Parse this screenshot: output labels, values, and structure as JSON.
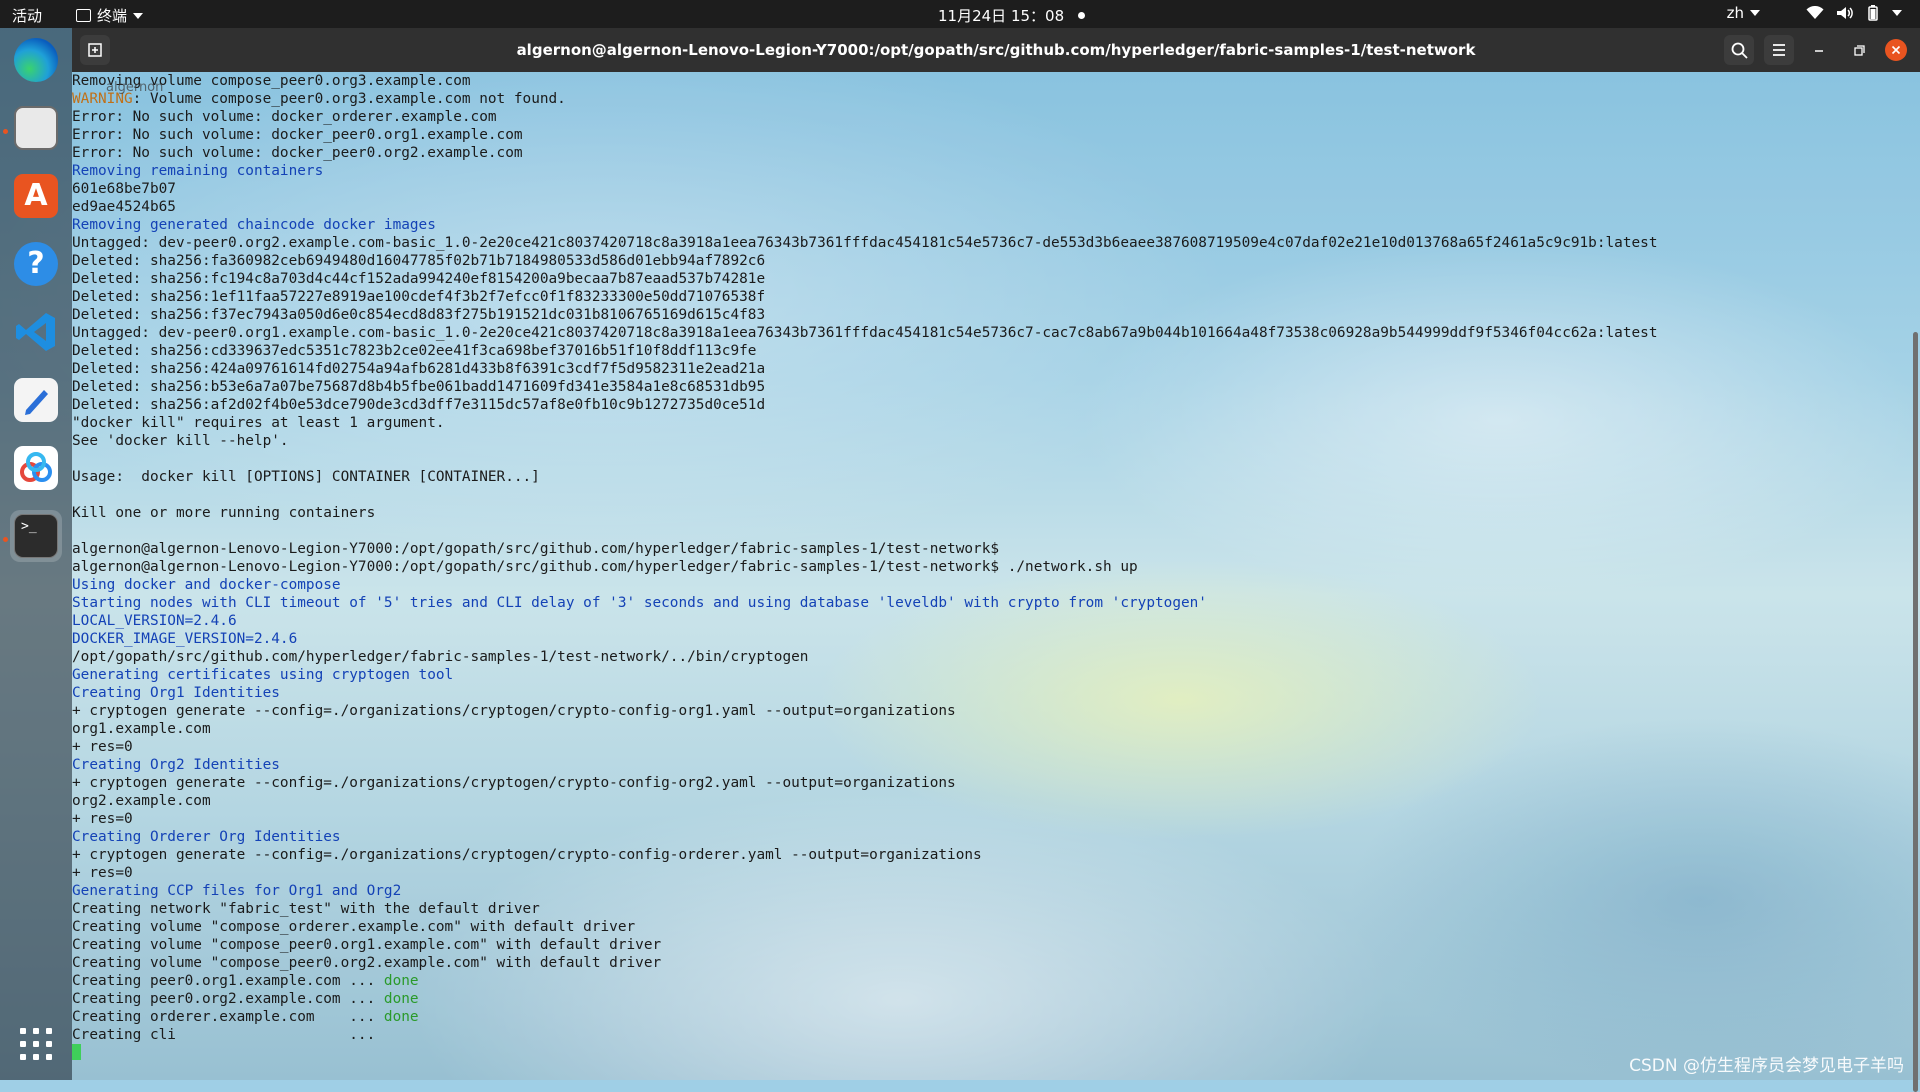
{
  "topbar": {
    "activities": "活动",
    "app_menu": "终端",
    "clock": "11月24日  15：08",
    "input_method": "zh"
  },
  "desktop": {
    "ghost_label": "algernon"
  },
  "dock": {
    "items": [
      {
        "name": "edge",
        "icon": "edge-icon"
      },
      {
        "name": "files",
        "icon": "files-icon"
      },
      {
        "name": "software",
        "icon": "software-store-icon"
      },
      {
        "name": "help",
        "icon": "help-icon"
      },
      {
        "name": "vscode",
        "icon": "vscode-icon"
      },
      {
        "name": "text-editor",
        "icon": "text-editor-icon"
      },
      {
        "name": "baidu-netdisk",
        "icon": "baidu-netdisk-icon"
      },
      {
        "name": "terminal",
        "icon": "terminal-icon"
      }
    ],
    "show_apps": "show-apps-icon"
  },
  "window": {
    "title": "algernon@algernon-Lenovo-Legion-Y7000:/opt/gopath/src/github.com/hyperledger/fabric-samples-1/test-network"
  },
  "terminal": {
    "lines": [
      [
        {
          "t": "Removing volume compose_peer0.org3.example.com"
        }
      ],
      [
        {
          "t": "WARNING",
          "c": "warn"
        },
        {
          "t": ": Volume compose_peer0.org3.example.com not found."
        }
      ],
      [
        {
          "t": "Error: No such volume: docker_orderer.example.com"
        }
      ],
      [
        {
          "t": "Error: No such volume: docker_peer0.org1.example.com"
        }
      ],
      [
        {
          "t": "Error: No such volume: docker_peer0.org2.example.com"
        }
      ],
      [
        {
          "t": "Removing remaining containers",
          "c": "blue"
        }
      ],
      [
        {
          "t": "601e68be7b07"
        }
      ],
      [
        {
          "t": "ed9ae4524b65"
        }
      ],
      [
        {
          "t": "Removing generated chaincode docker images",
          "c": "blue"
        }
      ],
      [
        {
          "t": "Untagged: dev-peer0.org2.example.com-basic_1.0-2e20ce421c8037420718c8a3918a1eea76343b7361fffdac454181c54e5736c7-de553d3b6eaee387608719509e4c07daf02e21e10d013768a65f2461a5c9c91b:latest"
        }
      ],
      [
        {
          "t": "Deleted: sha256:fa360982ceb6949480d16047785f02b71b7184980533d586d01ebb94af7892c6"
        }
      ],
      [
        {
          "t": "Deleted: sha256:fc194c8a703d4c44cf152ada994240ef8154200a9becaa7b87eaad537b74281e"
        }
      ],
      [
        {
          "t": "Deleted: sha256:1ef11faa57227e8919ae100cdef4f3b2f7efcc0f1f83233300e50dd71076538f"
        }
      ],
      [
        {
          "t": "Deleted: sha256:f37ec7943a050d6e0c854ecd8d83f275b191521dc031b8106765169d615c4f83"
        }
      ],
      [
        {
          "t": "Untagged: dev-peer0.org1.example.com-basic_1.0-2e20ce421c8037420718c8a3918a1eea76343b7361fffdac454181c54e5736c7-cac7c8ab67a9b044b101664a48f73538c06928a9b544999ddf9f5346f04cc62a:latest"
        }
      ],
      [
        {
          "t": "Deleted: sha256:cd339637edc5351c7823b2ce02ee41f3ca698bef37016b51f10f8ddf113c9fe"
        }
      ],
      [
        {
          "t": "Deleted: sha256:424a09761614fd02754a94afb6281d433b8f6391c3cdf7f5d9582311e2ead21a"
        }
      ],
      [
        {
          "t": "Deleted: sha256:b53e6a7a07be75687d8b4b5fbe061badd1471609fd341e3584a1e8c68531db95"
        }
      ],
      [
        {
          "t": "Deleted: sha256:af2d02f4b0e53dce790de3cd3dff7e3115dc57af8e0fb10c9b1272735d0ce51d"
        }
      ],
      [
        {
          "t": "\"docker kill\" requires at least 1 argument."
        }
      ],
      [
        {
          "t": "See 'docker kill --help'."
        }
      ],
      [
        {
          "t": ""
        }
      ],
      [
        {
          "t": "Usage:  docker kill [OPTIONS] CONTAINER [CONTAINER...]"
        }
      ],
      [
        {
          "t": ""
        }
      ],
      [
        {
          "t": "Kill one or more running containers"
        }
      ],
      [
        {
          "t": ""
        }
      ],
      [
        {
          "t": "algernon@algernon-Lenovo-Legion-Y7000:/opt/gopath/src/github.com/hyperledger/fabric-samples-1/test-network$"
        }
      ],
      [
        {
          "t": "algernon@algernon-Lenovo-Legion-Y7000:/opt/gopath/src/github.com/hyperledger/fabric-samples-1/test-network$ ./network.sh up"
        }
      ],
      [
        {
          "t": "Using docker and docker-compose",
          "c": "blue"
        }
      ],
      [
        {
          "t": "Starting nodes with CLI timeout of '5' tries and CLI delay of '3' seconds and using database 'leveldb' with crypto from 'cryptogen'",
          "c": "blue"
        }
      ],
      [
        {
          "t": "LOCAL_VERSION=2.4.6",
          "c": "blue"
        }
      ],
      [
        {
          "t": "DOCKER_IMAGE_VERSION=2.4.6",
          "c": "blue"
        }
      ],
      [
        {
          "t": "/opt/gopath/src/github.com/hyperledger/fabric-samples-1/test-network/../bin/cryptogen"
        }
      ],
      [
        {
          "t": "Generating certificates using cryptogen tool",
          "c": "blue"
        }
      ],
      [
        {
          "t": "Creating Org1 Identities",
          "c": "blue"
        }
      ],
      [
        {
          "t": "+ cryptogen generate --config=./organizations/cryptogen/crypto-config-org1.yaml --output=organizations"
        }
      ],
      [
        {
          "t": "org1.example.com"
        }
      ],
      [
        {
          "t": "+ res=0"
        }
      ],
      [
        {
          "t": "Creating Org2 Identities",
          "c": "blue"
        }
      ],
      [
        {
          "t": "+ cryptogen generate --config=./organizations/cryptogen/crypto-config-org2.yaml --output=organizations"
        }
      ],
      [
        {
          "t": "org2.example.com"
        }
      ],
      [
        {
          "t": "+ res=0"
        }
      ],
      [
        {
          "t": "Creating Orderer Org Identities",
          "c": "blue"
        }
      ],
      [
        {
          "t": "+ cryptogen generate --config=./organizations/cryptogen/crypto-config-orderer.yaml --output=organizations"
        }
      ],
      [
        {
          "t": "+ res=0"
        }
      ],
      [
        {
          "t": "Generating CCP files for Org1 and Org2",
          "c": "blue"
        }
      ],
      [
        {
          "t": "Creating network \"fabric_test\" with the default driver"
        }
      ],
      [
        {
          "t": "Creating volume \"compose_orderer.example.com\" with default driver"
        }
      ],
      [
        {
          "t": "Creating volume \"compose_peer0.org1.example.com\" with default driver"
        }
      ],
      [
        {
          "t": "Creating volume \"compose_peer0.org2.example.com\" with default driver"
        }
      ],
      [
        {
          "t": "Creating peer0.org1.example.com ... "
        },
        {
          "t": "done",
          "c": "green"
        }
      ],
      [
        {
          "t": "Creating peer0.org2.example.com ... "
        },
        {
          "t": "done",
          "c": "green"
        }
      ],
      [
        {
          "t": "Creating orderer.example.com    ... "
        },
        {
          "t": "done",
          "c": "green"
        }
      ],
      [
        {
          "t": "Creating cli                    ..."
        }
      ]
    ]
  },
  "watermark": "CSDN @仿生程序员会梦见电子羊吗",
  "colors": {
    "topbar": "#1d1d1d",
    "titlebar": "#303030",
    "close_button": "#e95420",
    "prompt_blue": "#1442b6",
    "warning_orange": "#c07018",
    "done_green": "#2a9a2a"
  }
}
